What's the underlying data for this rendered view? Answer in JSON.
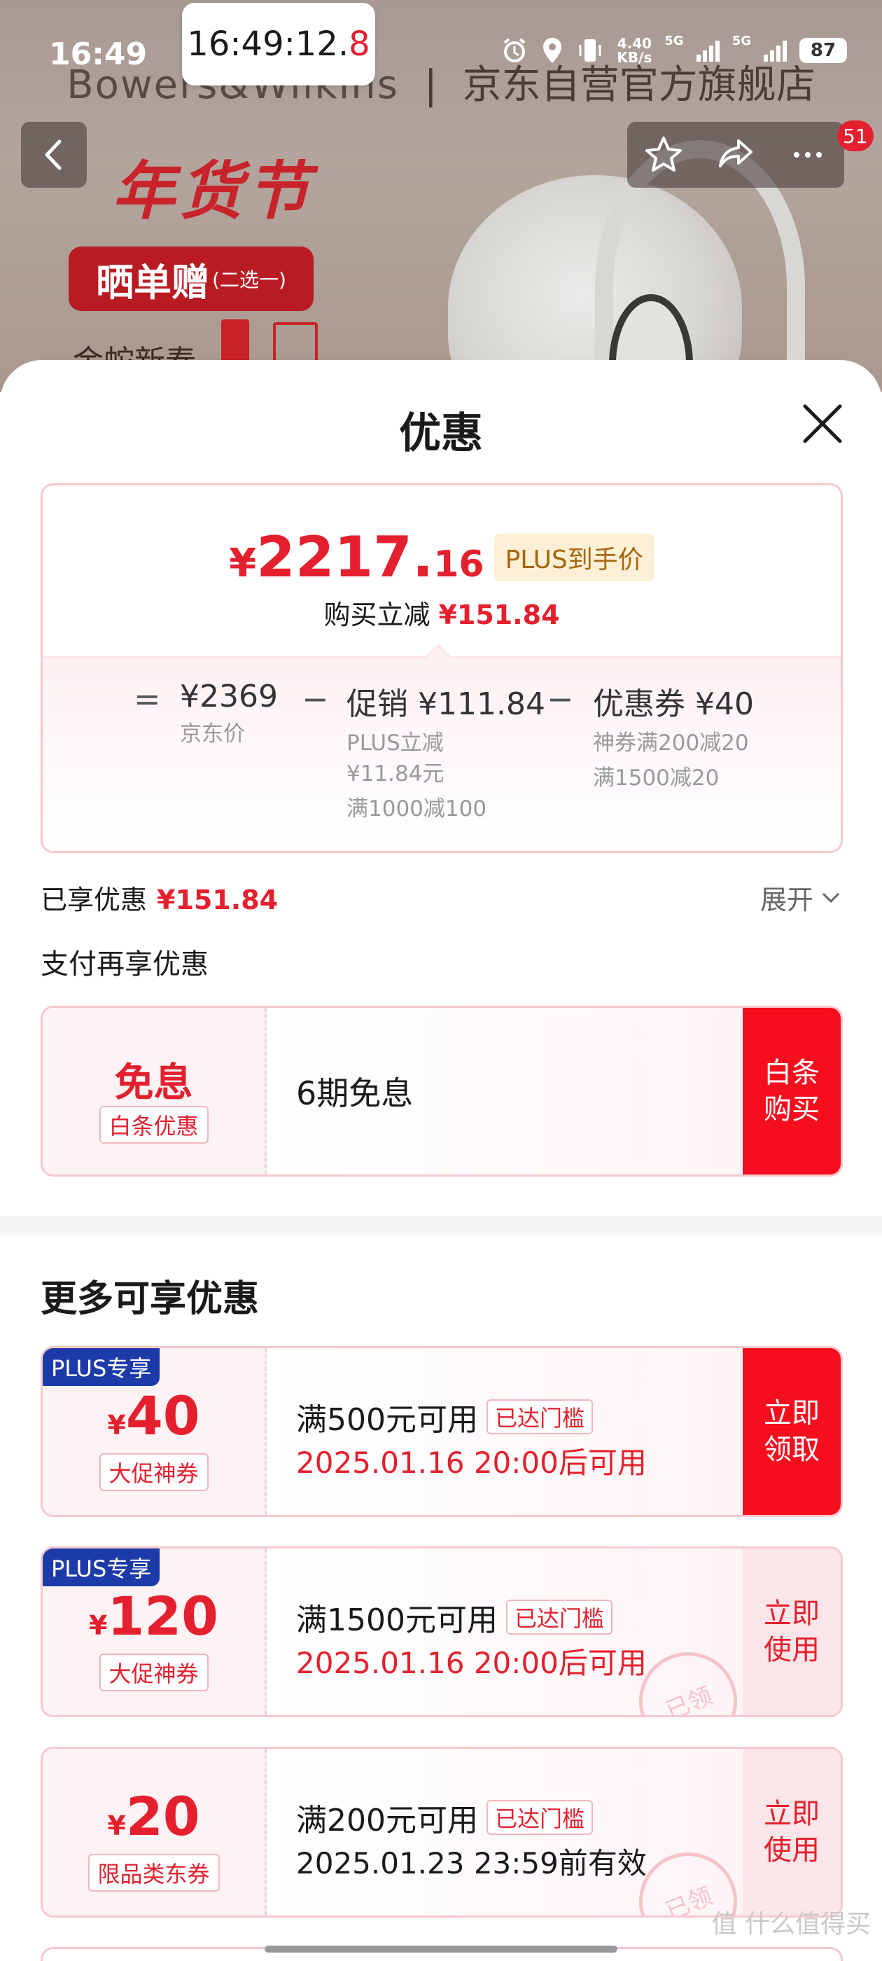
{
  "status_bar": {
    "time": "16:49",
    "clock_main": "16:49:12.",
    "clock_red": "8",
    "net_speed_top": "4.40",
    "net_speed_bottom": "KB/s",
    "net_type_1": "5G",
    "net_type_2": "5G",
    "battery": "87"
  },
  "background": {
    "brand": "Bowers&Wilkins",
    "store": "京东自营官方旗舰店",
    "banner_title": "年货节",
    "banner_tag": "晒单赠",
    "banner_tag_sub": "(二选一)",
    "banner_sub": "金蛇新春",
    "badge_count": "51"
  },
  "sheet": {
    "title": "优惠",
    "price": {
      "yen": "¥",
      "integer": "2217.",
      "decimal": "16",
      "tag": "PLUS到手价",
      "reduce_label": "购买立减",
      "reduce_value": "¥151.84"
    },
    "breakdown": {
      "op_equal": "=",
      "op_minus1": "−",
      "op_minus2": "−",
      "jd_price": "¥2369",
      "jd_price_label": "京东价",
      "promo": "促销 ¥111.84",
      "promo_line1": "PLUS立减",
      "promo_line2": "¥11.84元",
      "promo_line3": "满1000减100",
      "coupon": "优惠券 ¥40",
      "coupon_line1": "神券满200减20",
      "coupon_line2": "满1500减20"
    },
    "enjoyed_label": "已享优惠",
    "enjoyed_value": "¥151.84",
    "expand_label": "展开",
    "pay_title": "支付再享优惠",
    "baitiao": {
      "title": "免息",
      "tag": "白条优惠",
      "name": "6期免息",
      "action": "白条\n购买"
    },
    "more_title": "更多可享优惠",
    "coupons": [
      {
        "plus": "PLUS专享",
        "yen": "¥",
        "amount": "40",
        "tag": "大促神券",
        "title": "满500元可用",
        "reached": "已达门槛",
        "time": "2025.01.16 20:00后可用",
        "action": "立即\n领取"
      },
      {
        "plus": "PLUS专享",
        "yen": "¥",
        "amount": "120",
        "tag": "大促神券",
        "title": "满1500元可用",
        "reached": "已达门槛",
        "time": "2025.01.16 20:00后可用",
        "action": "立即\n使用",
        "stamp": "已领"
      },
      {
        "yen": "¥",
        "amount": "20",
        "tag": "限品类东券",
        "title": "满200元可用",
        "reached": "已达门槛",
        "time": "2025.01.23 23:59前有效",
        "action": "立即\n使用",
        "stamp": "已领"
      }
    ]
  },
  "watermark": "值 什么值得买",
  "colors": {
    "accent": "#e4202e",
    "plus_blue": "#1d3ba8",
    "card_border": "#f7c8cd"
  }
}
